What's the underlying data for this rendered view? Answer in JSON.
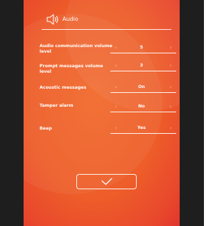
{
  "header": {
    "title": "Audio",
    "icon": "speaker-volume-icon"
  },
  "settings": [
    {
      "label": "Audio communication volume level",
      "value": "5"
    },
    {
      "label": "Prompt messages volume level",
      "value": "3"
    },
    {
      "label": "Acoustic messages",
      "value": "On"
    },
    {
      "label": "Tamper alarm",
      "value": "No"
    },
    {
      "label": "Beep",
      "value": "Yes"
    }
  ],
  "arrows": {
    "prev": "‹",
    "next": "›"
  },
  "confirm": {
    "icon": "checkmark-icon"
  },
  "colors": {
    "background_start": "#f26a2c",
    "background_end": "#e2352e",
    "side_bars": "#1e1e1e",
    "foreground": "#ffffff"
  }
}
